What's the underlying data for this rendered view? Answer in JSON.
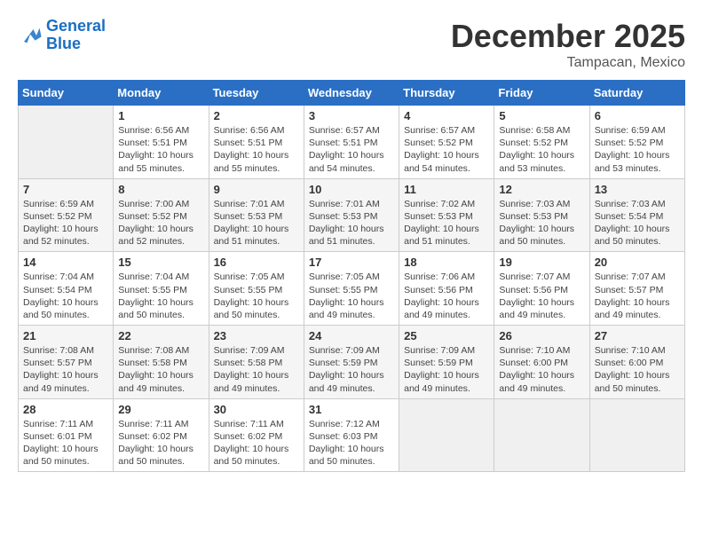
{
  "logo": {
    "line1": "General",
    "line2": "Blue"
  },
  "title": "December 2025",
  "location": "Tampacan, Mexico",
  "days_of_week": [
    "Sunday",
    "Monday",
    "Tuesday",
    "Wednesday",
    "Thursday",
    "Friday",
    "Saturday"
  ],
  "weeks": [
    [
      {
        "day": "",
        "sunrise": "",
        "sunset": "",
        "daylight": ""
      },
      {
        "day": "1",
        "sunrise": "Sunrise: 6:56 AM",
        "sunset": "Sunset: 5:51 PM",
        "daylight": "Daylight: 10 hours and 55 minutes."
      },
      {
        "day": "2",
        "sunrise": "Sunrise: 6:56 AM",
        "sunset": "Sunset: 5:51 PM",
        "daylight": "Daylight: 10 hours and 55 minutes."
      },
      {
        "day": "3",
        "sunrise": "Sunrise: 6:57 AM",
        "sunset": "Sunset: 5:51 PM",
        "daylight": "Daylight: 10 hours and 54 minutes."
      },
      {
        "day": "4",
        "sunrise": "Sunrise: 6:57 AM",
        "sunset": "Sunset: 5:52 PM",
        "daylight": "Daylight: 10 hours and 54 minutes."
      },
      {
        "day": "5",
        "sunrise": "Sunrise: 6:58 AM",
        "sunset": "Sunset: 5:52 PM",
        "daylight": "Daylight: 10 hours and 53 minutes."
      },
      {
        "day": "6",
        "sunrise": "Sunrise: 6:59 AM",
        "sunset": "Sunset: 5:52 PM",
        "daylight": "Daylight: 10 hours and 53 minutes."
      }
    ],
    [
      {
        "day": "7",
        "sunrise": "Sunrise: 6:59 AM",
        "sunset": "Sunset: 5:52 PM",
        "daylight": "Daylight: 10 hours and 52 minutes."
      },
      {
        "day": "8",
        "sunrise": "Sunrise: 7:00 AM",
        "sunset": "Sunset: 5:52 PM",
        "daylight": "Daylight: 10 hours and 52 minutes."
      },
      {
        "day": "9",
        "sunrise": "Sunrise: 7:01 AM",
        "sunset": "Sunset: 5:53 PM",
        "daylight": "Daylight: 10 hours and 51 minutes."
      },
      {
        "day": "10",
        "sunrise": "Sunrise: 7:01 AM",
        "sunset": "Sunset: 5:53 PM",
        "daylight": "Daylight: 10 hours and 51 minutes."
      },
      {
        "day": "11",
        "sunrise": "Sunrise: 7:02 AM",
        "sunset": "Sunset: 5:53 PM",
        "daylight": "Daylight: 10 hours and 51 minutes."
      },
      {
        "day": "12",
        "sunrise": "Sunrise: 7:03 AM",
        "sunset": "Sunset: 5:53 PM",
        "daylight": "Daylight: 10 hours and 50 minutes."
      },
      {
        "day": "13",
        "sunrise": "Sunrise: 7:03 AM",
        "sunset": "Sunset: 5:54 PM",
        "daylight": "Daylight: 10 hours and 50 minutes."
      }
    ],
    [
      {
        "day": "14",
        "sunrise": "Sunrise: 7:04 AM",
        "sunset": "Sunset: 5:54 PM",
        "daylight": "Daylight: 10 hours and 50 minutes."
      },
      {
        "day": "15",
        "sunrise": "Sunrise: 7:04 AM",
        "sunset": "Sunset: 5:55 PM",
        "daylight": "Daylight: 10 hours and 50 minutes."
      },
      {
        "day": "16",
        "sunrise": "Sunrise: 7:05 AM",
        "sunset": "Sunset: 5:55 PM",
        "daylight": "Daylight: 10 hours and 50 minutes."
      },
      {
        "day": "17",
        "sunrise": "Sunrise: 7:05 AM",
        "sunset": "Sunset: 5:55 PM",
        "daylight": "Daylight: 10 hours and 49 minutes."
      },
      {
        "day": "18",
        "sunrise": "Sunrise: 7:06 AM",
        "sunset": "Sunset: 5:56 PM",
        "daylight": "Daylight: 10 hours and 49 minutes."
      },
      {
        "day": "19",
        "sunrise": "Sunrise: 7:07 AM",
        "sunset": "Sunset: 5:56 PM",
        "daylight": "Daylight: 10 hours and 49 minutes."
      },
      {
        "day": "20",
        "sunrise": "Sunrise: 7:07 AM",
        "sunset": "Sunset: 5:57 PM",
        "daylight": "Daylight: 10 hours and 49 minutes."
      }
    ],
    [
      {
        "day": "21",
        "sunrise": "Sunrise: 7:08 AM",
        "sunset": "Sunset: 5:57 PM",
        "daylight": "Daylight: 10 hours and 49 minutes."
      },
      {
        "day": "22",
        "sunrise": "Sunrise: 7:08 AM",
        "sunset": "Sunset: 5:58 PM",
        "daylight": "Daylight: 10 hours and 49 minutes."
      },
      {
        "day": "23",
        "sunrise": "Sunrise: 7:09 AM",
        "sunset": "Sunset: 5:58 PM",
        "daylight": "Daylight: 10 hours and 49 minutes."
      },
      {
        "day": "24",
        "sunrise": "Sunrise: 7:09 AM",
        "sunset": "Sunset: 5:59 PM",
        "daylight": "Daylight: 10 hours and 49 minutes."
      },
      {
        "day": "25",
        "sunrise": "Sunrise: 7:09 AM",
        "sunset": "Sunset: 5:59 PM",
        "daylight": "Daylight: 10 hours and 49 minutes."
      },
      {
        "day": "26",
        "sunrise": "Sunrise: 7:10 AM",
        "sunset": "Sunset: 6:00 PM",
        "daylight": "Daylight: 10 hours and 49 minutes."
      },
      {
        "day": "27",
        "sunrise": "Sunrise: 7:10 AM",
        "sunset": "Sunset: 6:00 PM",
        "daylight": "Daylight: 10 hours and 50 minutes."
      }
    ],
    [
      {
        "day": "28",
        "sunrise": "Sunrise: 7:11 AM",
        "sunset": "Sunset: 6:01 PM",
        "daylight": "Daylight: 10 hours and 50 minutes."
      },
      {
        "day": "29",
        "sunrise": "Sunrise: 7:11 AM",
        "sunset": "Sunset: 6:02 PM",
        "daylight": "Daylight: 10 hours and 50 minutes."
      },
      {
        "day": "30",
        "sunrise": "Sunrise: 7:11 AM",
        "sunset": "Sunset: 6:02 PM",
        "daylight": "Daylight: 10 hours and 50 minutes."
      },
      {
        "day": "31",
        "sunrise": "Sunrise: 7:12 AM",
        "sunset": "Sunset: 6:03 PM",
        "daylight": "Daylight: 10 hours and 50 minutes."
      },
      {
        "day": "",
        "sunrise": "",
        "sunset": "",
        "daylight": ""
      },
      {
        "day": "",
        "sunrise": "",
        "sunset": "",
        "daylight": ""
      },
      {
        "day": "",
        "sunrise": "",
        "sunset": "",
        "daylight": ""
      }
    ]
  ]
}
